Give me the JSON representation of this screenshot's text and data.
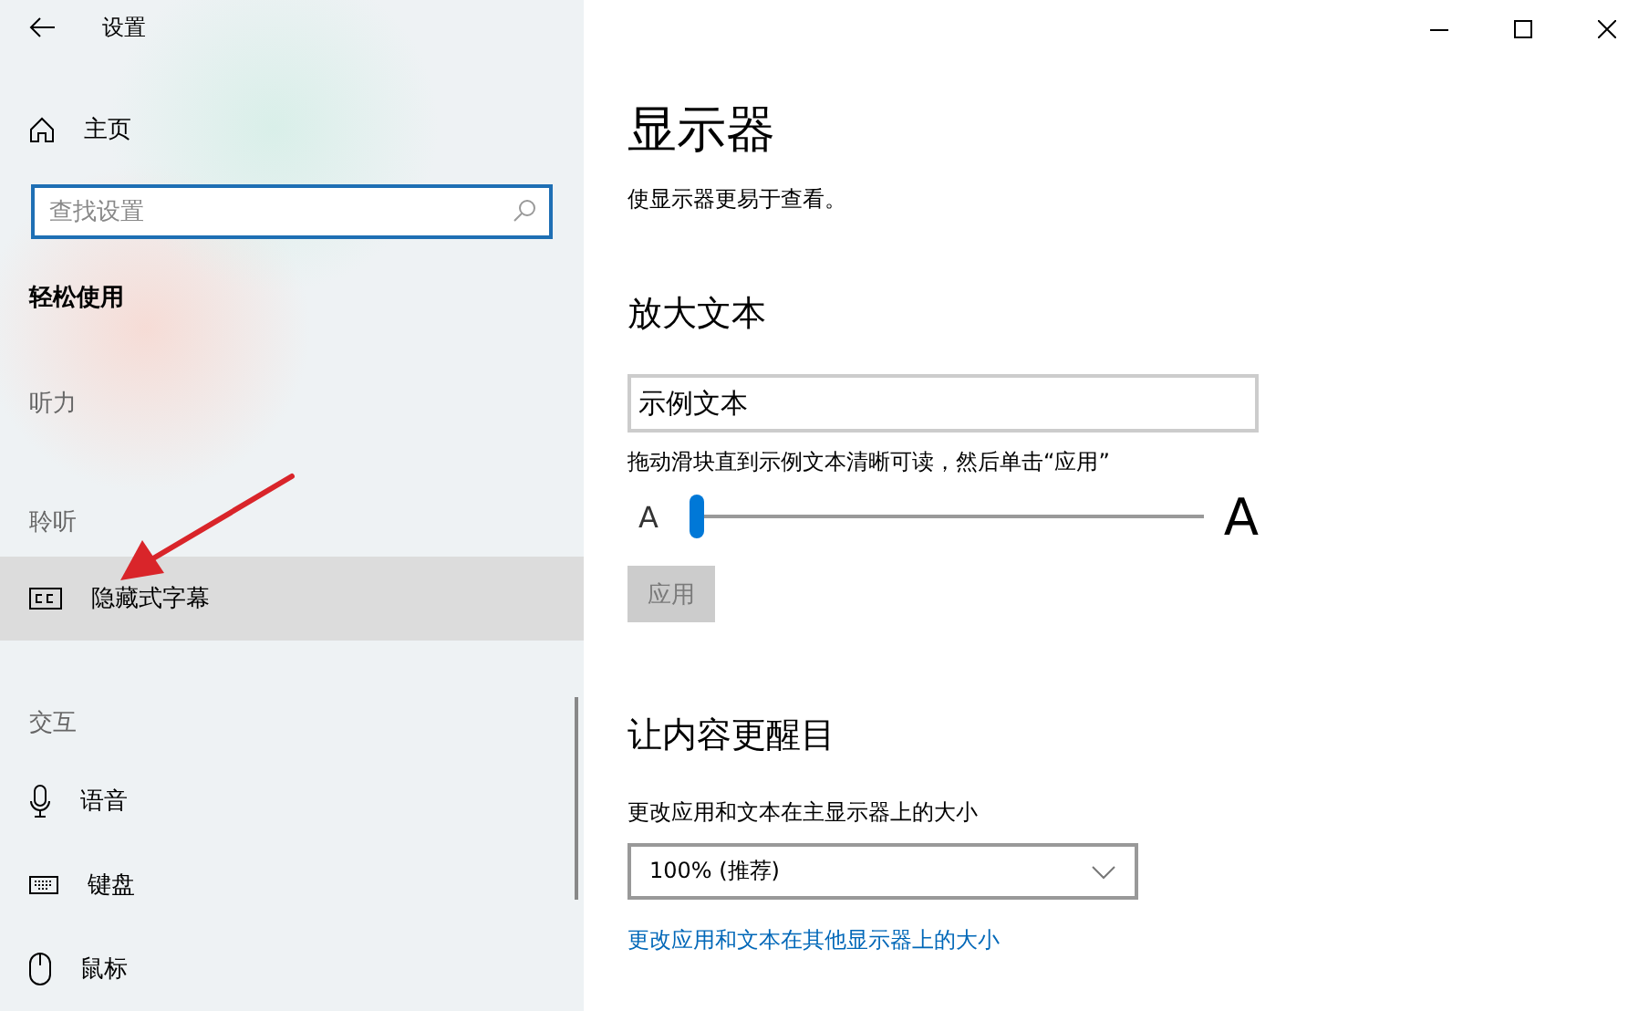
{
  "window": {
    "title": "设置"
  },
  "sidebar": {
    "home": "主页",
    "search": {
      "placeholder": "查找设置"
    },
    "section_title": "轻松使用",
    "items": [
      {
        "kind": "heading",
        "label": "听力"
      },
      {
        "kind": "heading",
        "label": "聆听"
      },
      {
        "kind": "link",
        "label": "隐藏式字幕",
        "selected": true
      },
      {
        "kind": "heading",
        "label": "交互"
      },
      {
        "kind": "link",
        "label": "语音",
        "selected": false
      },
      {
        "kind": "link",
        "label": "键盘",
        "selected": false
      },
      {
        "kind": "link",
        "label": "鼠标",
        "selected": false
      }
    ]
  },
  "page": {
    "title": "显示器",
    "description": "使显示器更易于查看。",
    "sections": [
      {
        "title": "放大文本",
        "sample": "示例文本",
        "hint": "拖动滑块直到示例文本清晰可读，然后单击“应用”",
        "slider": {
          "small_label": "A",
          "large_label": "A",
          "level": 0
        },
        "apply": {
          "label": "应用",
          "disabled": true
        }
      },
      {
        "title": "让内容更醒目",
        "label": "更改应用和文本在主显示器上的大小",
        "dropdown": "100% (推荐)",
        "link": "更改应用和文本在其他显示器上的大小"
      }
    ]
  }
}
